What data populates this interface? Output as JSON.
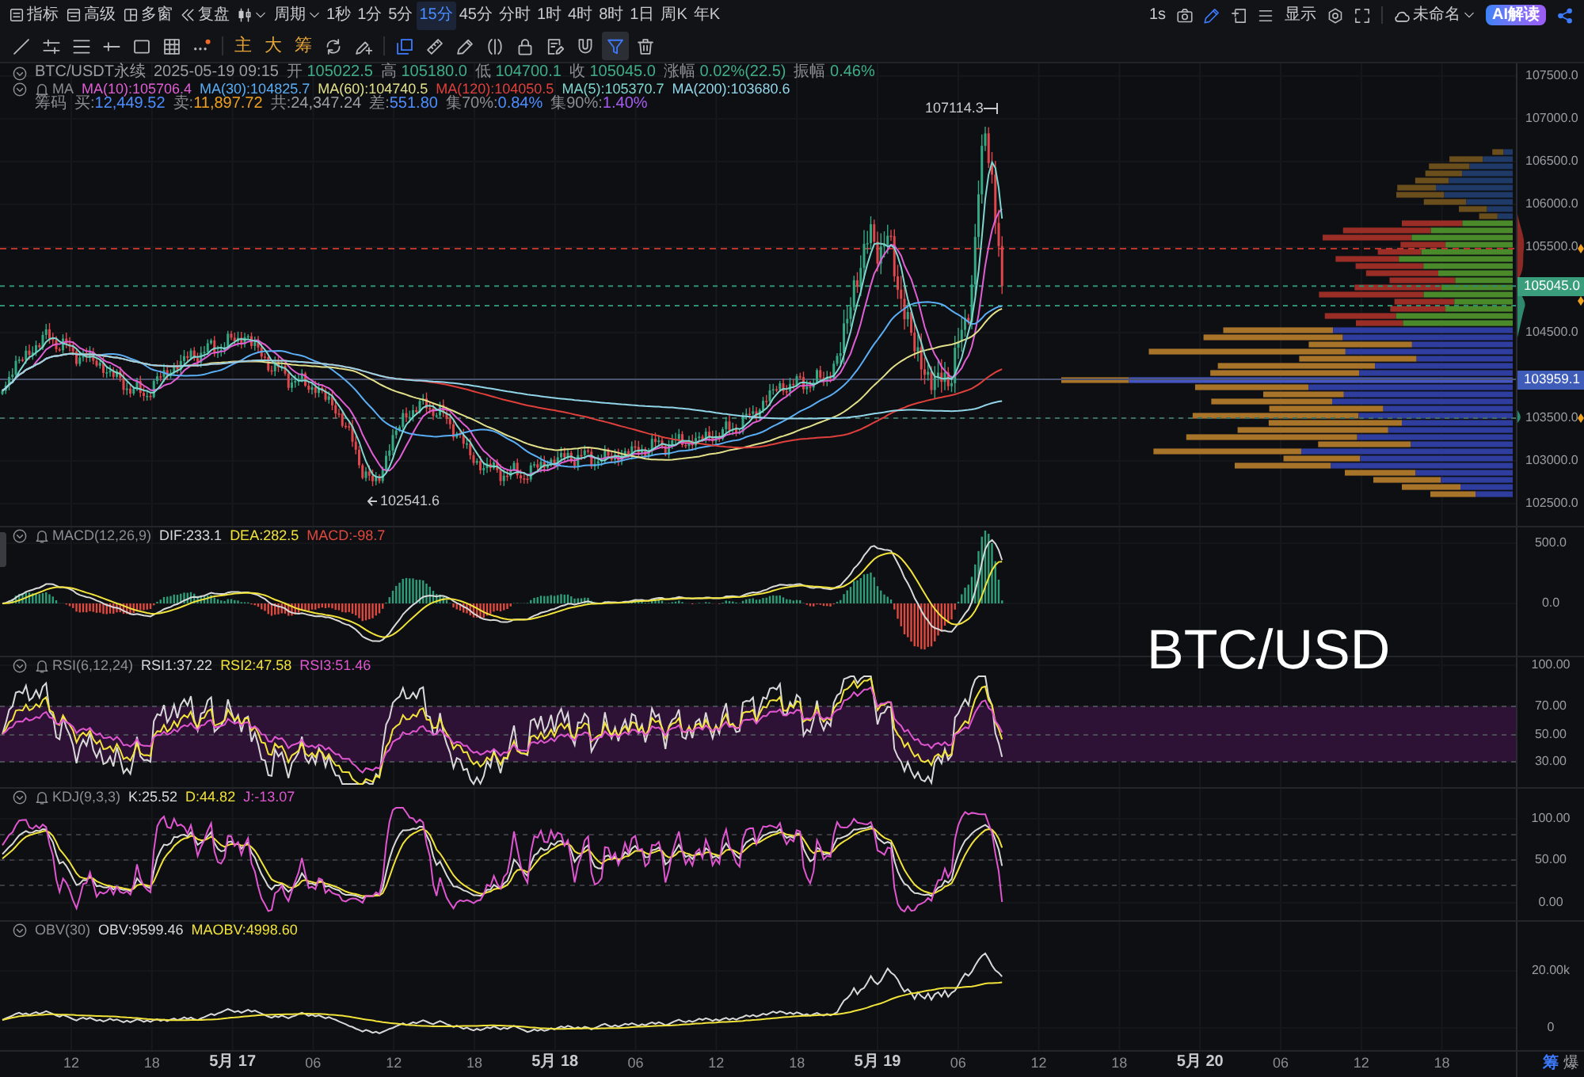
{
  "toolbar": {
    "menus": [
      {
        "kind": "indicators",
        "label": "指标"
      },
      {
        "kind": "advanced",
        "label": "高级"
      },
      {
        "kind": "windows",
        "label": "多窗"
      },
      {
        "kind": "replay",
        "label": "复盘"
      },
      {
        "kind": "chart_type"
      },
      {
        "kind": "dropdown",
        "label": "周期"
      }
    ],
    "periods": [
      {
        "label": "1秒",
        "selected": false
      },
      {
        "label": "1分",
        "selected": false
      },
      {
        "label": "5分",
        "selected": false
      },
      {
        "label": "15分",
        "selected": true
      },
      {
        "label": "45分",
        "selected": false
      },
      {
        "label": "分时",
        "selected": false
      },
      {
        "label": "1时",
        "selected": false
      },
      {
        "label": "4时",
        "selected": false
      },
      {
        "label": "8时",
        "selected": false
      },
      {
        "label": "1日",
        "selected": false
      },
      {
        "label": "周K",
        "selected": false
      },
      {
        "label": "年K",
        "selected": false
      }
    ],
    "right_controls": [
      {
        "kind": "interval",
        "label": "1s"
      },
      {
        "kind": "camera"
      },
      {
        "kind": "pencil"
      },
      {
        "kind": "frame"
      },
      {
        "kind": "list"
      },
      {
        "kind": "display",
        "label": "显示"
      },
      {
        "kind": "settings"
      },
      {
        "kind": "fullscreen"
      },
      {
        "kind": "layout",
        "label": "未命名"
      },
      {
        "kind": "ai",
        "label": "AI解读"
      },
      {
        "kind": "share"
      }
    ]
  },
  "drawing_toolbar": {
    "draw_tools": [
      {
        "kind": "trend_line"
      },
      {
        "kind": "parallel"
      },
      {
        "kind": "fib"
      },
      {
        "kind": "hray"
      },
      {
        "kind": "rectangle"
      },
      {
        "kind": "table"
      },
      {
        "kind": "more"
      }
    ],
    "overlay_tools": [
      {
        "kind": "text",
        "label": "主"
      },
      {
        "kind": "text",
        "label": "大"
      },
      {
        "kind": "text",
        "label": "筹"
      },
      {
        "kind": "refresh"
      },
      {
        "kind": "pen_plus"
      }
    ],
    "edit_tools": [
      {
        "kind": "squares",
        "selected": false
      },
      {
        "kind": "ruler",
        "selected": false
      },
      {
        "kind": "pen",
        "selected": false
      },
      {
        "kind": "brackets",
        "selected": false
      },
      {
        "kind": "lock",
        "selected": false
      },
      {
        "kind": "note",
        "selected": false
      },
      {
        "kind": "magnet",
        "selected": false
      },
      {
        "kind": "filter",
        "selected": true
      },
      {
        "kind": "trash",
        "selected": false
      }
    ]
  },
  "symbol_legend": {
    "symbol": "BTC/USDT永续",
    "time": "2025-05-19 09:15",
    "fields": [
      {
        "label": "开",
        "value": "105022.5"
      },
      {
        "label": "高",
        "value": "105180.0"
      },
      {
        "label": "低",
        "value": "104700.1"
      },
      {
        "label": "收",
        "value": "105045.0"
      },
      {
        "label": "涨幅",
        "value": "0.02%(22.5)"
      },
      {
        "label": "振幅",
        "value": "0.46%"
      }
    ]
  },
  "ma_legend": {
    "title": "MA",
    "alert": true,
    "lines": [
      {
        "text": "MA(10):105706.4",
        "color": "#e05fd5"
      },
      {
        "text": "MA(30):104825.7",
        "color": "#5aaef5"
      },
      {
        "text": "MA(60):104740.5",
        "color": "#e2e08a"
      },
      {
        "text": "MA(120):104050.5",
        "color": "#e0403c"
      },
      {
        "text": "MA(5):105370.7",
        "color": "#7fd6cf"
      },
      {
        "text": "MA(200):103680.6",
        "color": "#92d6ea"
      }
    ]
  },
  "chip_legend": {
    "title": "筹码",
    "stats": [
      {
        "label": "买:",
        "value": "12,449.52",
        "color": "#4d8dff"
      },
      {
        "label": "卖:",
        "value": "11,897.72",
        "color": "#f0a020"
      },
      {
        "label": "共:",
        "value": "24,347.24",
        "color": "#9a9ca3"
      },
      {
        "label": "差:",
        "value": "551.80",
        "color": "#4d8dff"
      },
      {
        "label": "集70%:",
        "value": "0.84%",
        "color": "#4d8dff"
      },
      {
        "label": "集90%:",
        "value": "1.40%",
        "color": "#a45df0"
      }
    ]
  },
  "price_chart": {
    "high_label": "107114.3",
    "low_label": "102541.6",
    "axis_ticks": [
      "107500.0",
      "107000.0",
      "106500.0",
      "106000.0",
      "105500.0",
      "104500.0",
      "103500.0",
      "103000.0",
      "102500.0"
    ],
    "price_tags": [
      {
        "text": "105045.0",
        "color": "#3a9e7d"
      },
      {
        "text": "103959.1",
        "color": "#3e5cb8"
      }
    ]
  },
  "indicators": [
    {
      "kind": "macd",
      "title": "MACD(12,26,9)",
      "alert": true,
      "values": [
        {
          "text": "DIF:233.1",
          "color": "#d9d9d9"
        },
        {
          "text": "DEA:282.5",
          "color": "#f2e33a"
        },
        {
          "text": "MACD:-98.7",
          "color": "#e0493f"
        }
      ],
      "axis_labels": [
        "500.0",
        "0.0"
      ]
    },
    {
      "kind": "rsi",
      "title": "RSI(6,12,24)",
      "alert": true,
      "values": [
        {
          "text": "RSI1:37.22",
          "color": "#d9d9d9"
        },
        {
          "text": "RSI2:47.58",
          "color": "#f2e33a"
        },
        {
          "text": "RSI3:51.46",
          "color": "#e055d0"
        }
      ],
      "axis_labels": [
        "100.00",
        "70.00",
        "50.00",
        "30.00"
      ]
    },
    {
      "kind": "kdj",
      "title": "KDJ(9,3,3)",
      "alert": true,
      "values": [
        {
          "text": "K:25.52",
          "color": "#d9d9d9"
        },
        {
          "text": "D:44.82",
          "color": "#f2e33a"
        },
        {
          "text": "J:-13.07",
          "color": "#e055d0"
        }
      ],
      "axis_labels": [
        "100.00",
        "50.00",
        "0.00"
      ]
    },
    {
      "kind": "obv",
      "title": "OBV(30)",
      "alert": false,
      "values": [
        {
          "text": "OBV:9599.46",
          "color": "#d9d9d9"
        },
        {
          "text": "MAOBV:4998.60",
          "color": "#f2e33a"
        }
      ],
      "axis_labels": [
        "20.00k",
        "0"
      ]
    }
  ],
  "time_axis": {
    "labels": [
      {
        "text": "12",
        "kind": "hour"
      },
      {
        "text": "18",
        "kind": "hour"
      },
      {
        "text": "5月 17",
        "kind": "day"
      },
      {
        "text": "06",
        "kind": "hour"
      },
      {
        "text": "12",
        "kind": "hour"
      },
      {
        "text": "18",
        "kind": "hour"
      },
      {
        "text": "5月 18",
        "kind": "day"
      },
      {
        "text": "06",
        "kind": "hour"
      },
      {
        "text": "12",
        "kind": "hour"
      },
      {
        "text": "18",
        "kind": "hour"
      },
      {
        "text": "5月 19",
        "kind": "day"
      },
      {
        "text": "06",
        "kind": "hour"
      },
      {
        "text": "12",
        "kind": "hour"
      },
      {
        "text": "18",
        "kind": "hour"
      },
      {
        "text": "5月 20",
        "kind": "day"
      },
      {
        "text": "06",
        "kind": "hour"
      },
      {
        "text": "12",
        "kind": "hour"
      },
      {
        "text": "18",
        "kind": "hour"
      }
    ]
  },
  "bottom_toggles": [
    {
      "label": "筹",
      "selected": true
    },
    {
      "label": "爆",
      "selected": false
    }
  ],
  "caption": "BTC/USD"
}
